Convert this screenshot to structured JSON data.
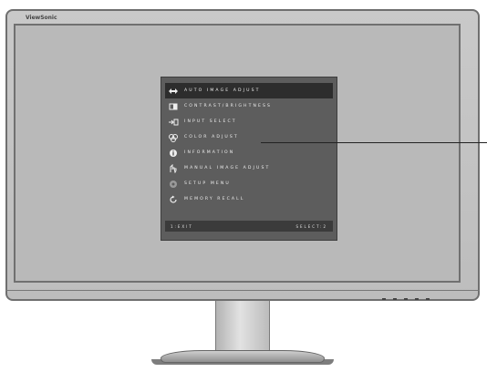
{
  "brand": "ViewSonic",
  "osd": {
    "items": [
      {
        "label": "AUTO IMAGE ADJUST",
        "icon": "auto-adjust-icon",
        "selected": true
      },
      {
        "label": "CONTRAST/BRIGHTNESS",
        "icon": "contrast-icon"
      },
      {
        "label": "INPUT SELECT",
        "icon": "input-select-icon"
      },
      {
        "label": "COLOR ADJUST",
        "icon": "color-adjust-icon"
      },
      {
        "label": "INFORMATION",
        "icon": "information-icon"
      },
      {
        "label": "MANUAL IMAGE ADJUST",
        "icon": "manual-adjust-icon"
      },
      {
        "label": "SETUP MENU",
        "icon": "setup-menu-icon"
      },
      {
        "label": "MEMORY RECALL",
        "icon": "memory-recall-icon"
      }
    ],
    "footer": {
      "exit": "1:EXIT",
      "select": "SELECT:2"
    }
  },
  "colors": {
    "osd_background": "#5d5d5d",
    "osd_selected": "#2d2d2d",
    "osd_text": "#ededed",
    "bezel": "#c4c4c4",
    "screen": "#b9b9b9"
  }
}
